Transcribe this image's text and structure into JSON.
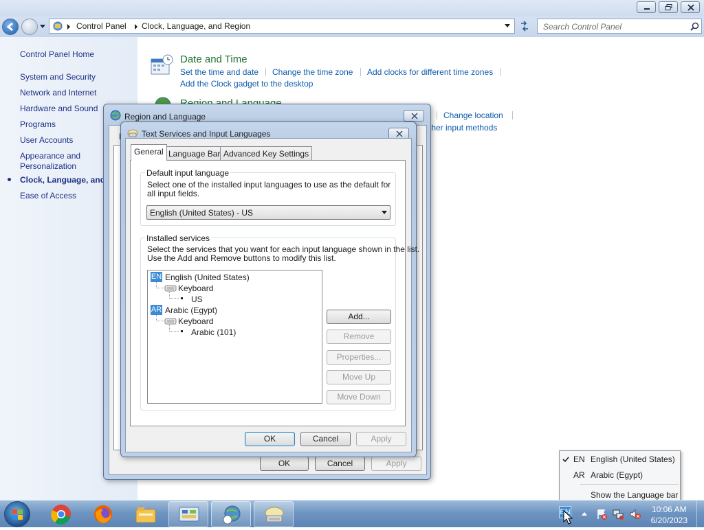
{
  "explorer": {
    "breadcrumb": [
      "Control Panel",
      "Clock, Language, and Region"
    ],
    "search_placeholder": "Search Control Panel"
  },
  "leftnav": {
    "home": "Control Panel Home",
    "items": [
      "System and Security",
      "Network and Internet",
      "Hardware and Sound",
      "Programs",
      "User Accounts",
      "Appearance and Personalization",
      "Clock, Language, and R",
      "Ease of Access"
    ]
  },
  "content": {
    "date_time": {
      "title": "Date and Time",
      "links": [
        "Set the time and date",
        "Change the time zone",
        "Add clocks for different time zones",
        "Add the Clock gadget to the desktop"
      ]
    },
    "region_language": {
      "title": "Region and Language",
      "links": [
        "Change location",
        "ther input methods"
      ]
    }
  },
  "region_dialog": {
    "title": "Region and Language",
    "tab_partial": "K",
    "ok": "OK",
    "cancel": "Cancel",
    "apply": "Apply"
  },
  "text_services_dialog": {
    "title": "Text Services and Input Languages",
    "tabs": [
      "General",
      "Language Bar",
      "Advanced Key Settings"
    ],
    "default_group": {
      "label": "Default input language",
      "description": "Select one of the installed input languages to use as the default for all input fields.",
      "selected": "English (United States) - US"
    },
    "installed_group": {
      "label": "Installed services",
      "description_line1": "Select the services that you want for each input language shown in the list.",
      "description_line2": "Use the Add and Remove buttons to modify this list."
    },
    "tree": [
      {
        "code": "EN",
        "language": "English (United States)",
        "category": "Keyboard",
        "layout": "US"
      },
      {
        "code": "AR",
        "language": "Arabic (Egypt)",
        "category": "Keyboard",
        "layout": "Arabic (101)"
      }
    ],
    "side_buttons": [
      "Add...",
      "Remove",
      "Properties...",
      "Move Up",
      "Move Down"
    ],
    "ok": "OK",
    "cancel": "Cancel",
    "apply": "Apply"
  },
  "language_menu": {
    "items": [
      {
        "code": "EN",
        "name": "English (United States)",
        "checked": true
      },
      {
        "code": "AR",
        "name": "Arabic (Egypt)",
        "checked": false
      }
    ],
    "show_bar": "Show the Language bar"
  },
  "taskbar": {
    "lang_indicator": "EN",
    "time": "10:06 AM",
    "date": "6/20/2023"
  },
  "colors": {
    "link": "#0d5cad",
    "category_title": "#1e6f2d",
    "lang_tag": "#3a8bd3"
  }
}
